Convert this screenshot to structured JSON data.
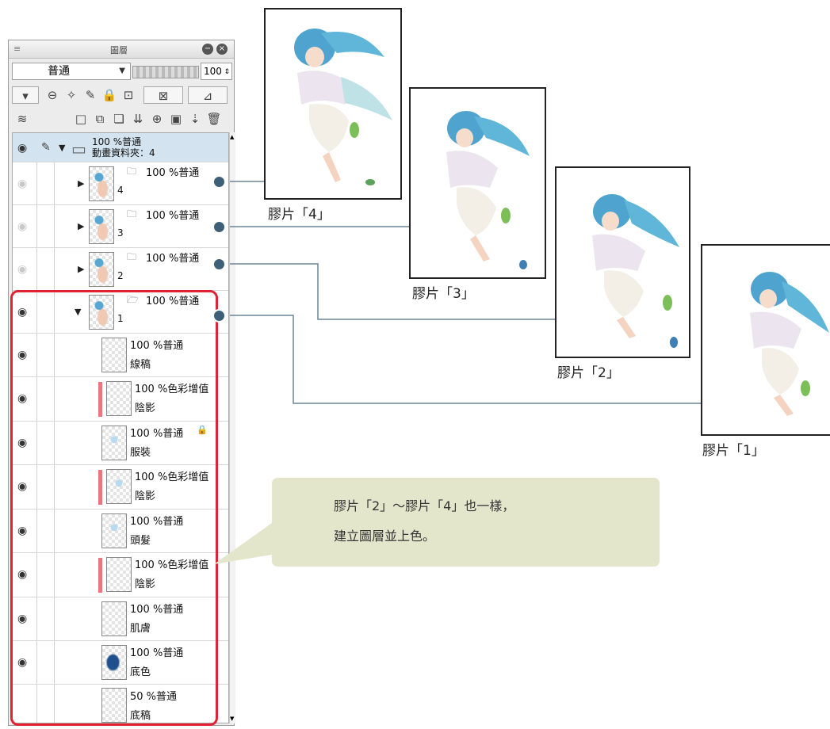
{
  "panel": {
    "menu_icon": "≡",
    "title": "圖層",
    "blend_mode": "普通",
    "opacity": "100",
    "layers": [
      {
        "opacity": "100 %普通",
        "name": "動畫資料夾：4"
      },
      {
        "opacity": "100 %普通",
        "name": "4"
      },
      {
        "opacity": "100 %普通",
        "name": "3"
      },
      {
        "opacity": "100 %普通",
        "name": "2"
      },
      {
        "opacity": "100 %普通",
        "name": "1"
      },
      {
        "opacity": "100 %普通",
        "name": "線稿"
      },
      {
        "opacity": "100 %色彩增值",
        "name": "陰影"
      },
      {
        "opacity": "100 %普通",
        "name": "服裝"
      },
      {
        "opacity": "100 %色彩增值",
        "name": "陰影"
      },
      {
        "opacity": "100 %普通",
        "name": "頭髮"
      },
      {
        "opacity": "100 %色彩增值",
        "name": "陰影"
      },
      {
        "opacity": "100 %普通",
        "name": "肌膚"
      },
      {
        "opacity": "100 %普通",
        "name": "底色"
      },
      {
        "opacity": "50 %普通",
        "name": "底稿"
      }
    ]
  },
  "cels": [
    {
      "label": "膠片「4」"
    },
    {
      "label": "膠片「3」"
    },
    {
      "label": "膠片「2」"
    },
    {
      "label": "膠片「1」"
    }
  ],
  "note": {
    "line1": "膠片「2」～膠片「4」也一樣，",
    "line2": "建立圖層並上色。"
  },
  "colors": {
    "highlight_border": "#e02233",
    "connector": "#3e5f78",
    "note_bg": "#e4e6cc",
    "clip_indicator": "#e9787e"
  }
}
